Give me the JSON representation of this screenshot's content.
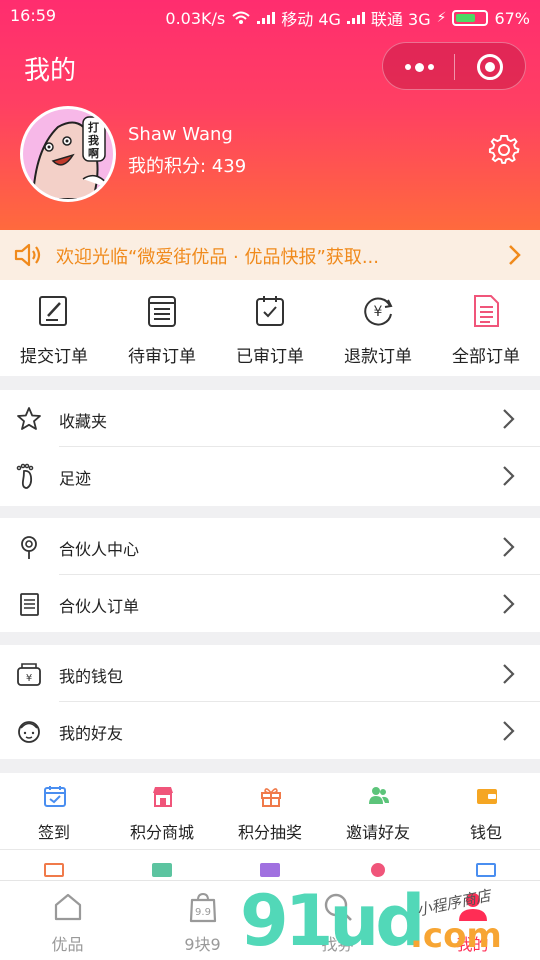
{
  "status_bar": {
    "time": "16:59",
    "speed": "0.03K/s",
    "carrier1": "移动 4G",
    "carrier2": "联通 3G",
    "battery": "67%",
    "battery_level": 0.67
  },
  "header": {
    "title": "我的",
    "user": {
      "avatar_text": "打我啊",
      "name": "Shaw Wang",
      "points": "我的积分: 439"
    }
  },
  "notice": {
    "text": "欢迎光临“微爱街优品 · 优品快报”获取..."
  },
  "orders": [
    {
      "label": "提交订单",
      "icon": "pen-doc-icon"
    },
    {
      "label": "待审订单",
      "icon": "list-doc-icon"
    },
    {
      "label": "已审订单",
      "icon": "check-doc-icon"
    },
    {
      "label": "退款订单",
      "icon": "refund-yen-icon"
    },
    {
      "label": "全部订单",
      "icon": "all-doc-icon"
    }
  ],
  "menu_groups": [
    [
      {
        "label": "收藏夹",
        "icon": "star-icon"
      },
      {
        "label": "足迹",
        "icon": "footprint-icon"
      }
    ],
    [
      {
        "label": "合伙人中心",
        "icon": "partner-pin-icon"
      },
      {
        "label": "合伙人订单",
        "icon": "partner-doc-icon"
      }
    ],
    [
      {
        "label": "我的钱包",
        "icon": "wallet-yen-icon"
      },
      {
        "label": "我的好友",
        "icon": "friend-face-icon"
      }
    ]
  ],
  "grid": [
    {
      "label": "签到",
      "icon": "calendar-check-icon",
      "color": "#4a8ef0"
    },
    {
      "label": "积分商城",
      "icon": "shop-icon",
      "color": "#f0557a"
    },
    {
      "label": "积分抽奖",
      "icon": "gift-icon",
      "color": "#f07a4a"
    },
    {
      "label": "邀请好友",
      "icon": "invite-users-icon",
      "color": "#5cc47a"
    },
    {
      "label": "钱包",
      "icon": "wallet-icon",
      "color": "#f5a623"
    }
  ],
  "tabs": [
    {
      "label": "优品",
      "icon": "home-icon",
      "active": false
    },
    {
      "label": "9块9",
      "icon": "bag-9-icon",
      "active": false
    },
    {
      "label": "找券",
      "icon": "search-icon",
      "active": false
    },
    {
      "label": "我的",
      "icon": "person-icon",
      "active": true
    }
  ],
  "watermark": {
    "main": "91ud",
    "suffix": ".com",
    "cn": "小程序商店"
  },
  "colors": {
    "accent": "#ff2d55",
    "notice_text": "#f08a1c"
  }
}
